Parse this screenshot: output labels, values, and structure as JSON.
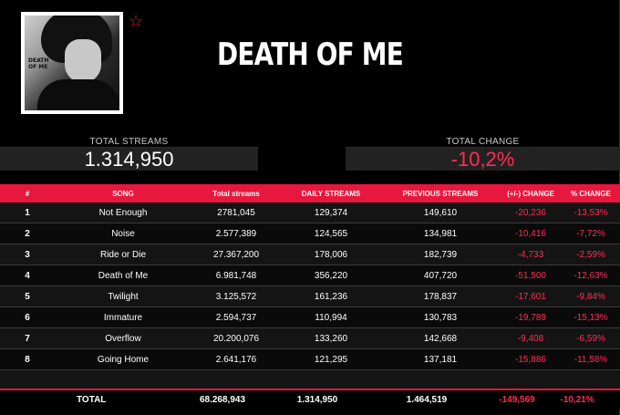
{
  "title": "DEATH OF ME",
  "cover": {
    "text_line1": "DEATH",
    "text_line2": "OF ME"
  },
  "stats": {
    "total_streams_label": "TOTAL STREAMS",
    "total_streams_value": "1.314,950",
    "total_change_label": "TOTAL CHANGE",
    "total_change_value": "-10,2%"
  },
  "table": {
    "headers": [
      "#",
      "SONG",
      "Total streams",
      "DAILY STREAMS",
      "PREVIOUS STREAMS",
      "(+/-) CHANGE",
      "% CHANGE"
    ],
    "rows": [
      [
        "1",
        "Not Enough",
        "2781,045",
        "129,374",
        "149,610",
        "-20,236",
        "-13,53%"
      ],
      [
        "2",
        "Noise",
        "2.577,389",
        "124,565",
        "134,981",
        "-10,416",
        "-7,72%"
      ],
      [
        "3",
        "Ride or Die",
        "27.367,200",
        "178,006",
        "182,739",
        "-4,733",
        "-2,59%"
      ],
      [
        "4",
        "Death of Me",
        "6.981,748",
        "356,220",
        "407,720",
        "-51,500",
        "-12,63%"
      ],
      [
        "5",
        "Twilight",
        "3.125,572",
        "161,236",
        "178,837",
        "-17,601",
        "-9,84%"
      ],
      [
        "6",
        "Immature",
        "2.594,737",
        "110,994",
        "130,783",
        "-19,789",
        "-15,13%"
      ],
      [
        "7",
        "Overflow",
        "20.200,076",
        "133,260",
        "142,668",
        "-9,408",
        "-6,59%"
      ],
      [
        "8",
        "Going Home",
        "2.641,176",
        "121,295",
        "137,181",
        "-15,886",
        "-11,58%"
      ]
    ],
    "total": [
      "TOTAL",
      "68.268,943",
      "1.314,950",
      "1.464,519",
      "-149,569",
      "-10,21%"
    ]
  },
  "colors": {
    "accent": "#e8173d",
    "negative": "#ff2d55",
    "background": "#000000"
  }
}
